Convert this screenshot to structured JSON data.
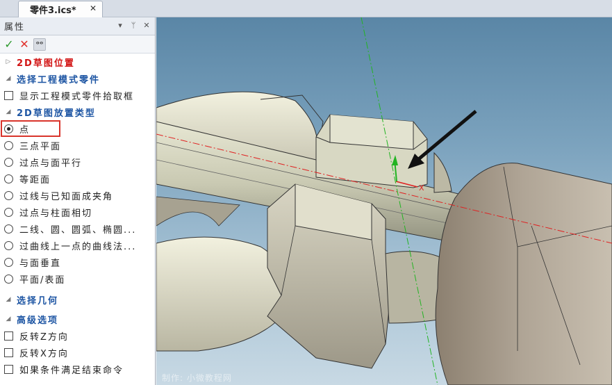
{
  "tab": {
    "title": "零件3.ics*"
  },
  "panel": {
    "title": "属性",
    "sections": {
      "sketch_position": "2D草图位置",
      "select_part": "选择工程模式零件",
      "placement_type": "2D草图放置类型",
      "select_geometry": "选择几何",
      "advanced": "高级选项"
    },
    "show_pick_box": "显示工程模式零件拾取框",
    "placement_options": [
      "点",
      "三点平面",
      "过点与面平行",
      "等距面",
      "过线与已知面成夹角",
      "过点与柱面相切",
      "二线、圆、圆弧、椭圆...",
      "过曲线上一点的曲线法...",
      "与面垂直",
      "平面/表面"
    ],
    "advanced_options": [
      "反转Z方向",
      "反转X方向",
      "如果条件满足结束命令"
    ]
  },
  "viewport": {
    "x_axis_label": "X"
  },
  "colors": {
    "accent_red": "#d21414",
    "section_blue": "#1d55a3",
    "highlight_box": "#d9342b"
  }
}
